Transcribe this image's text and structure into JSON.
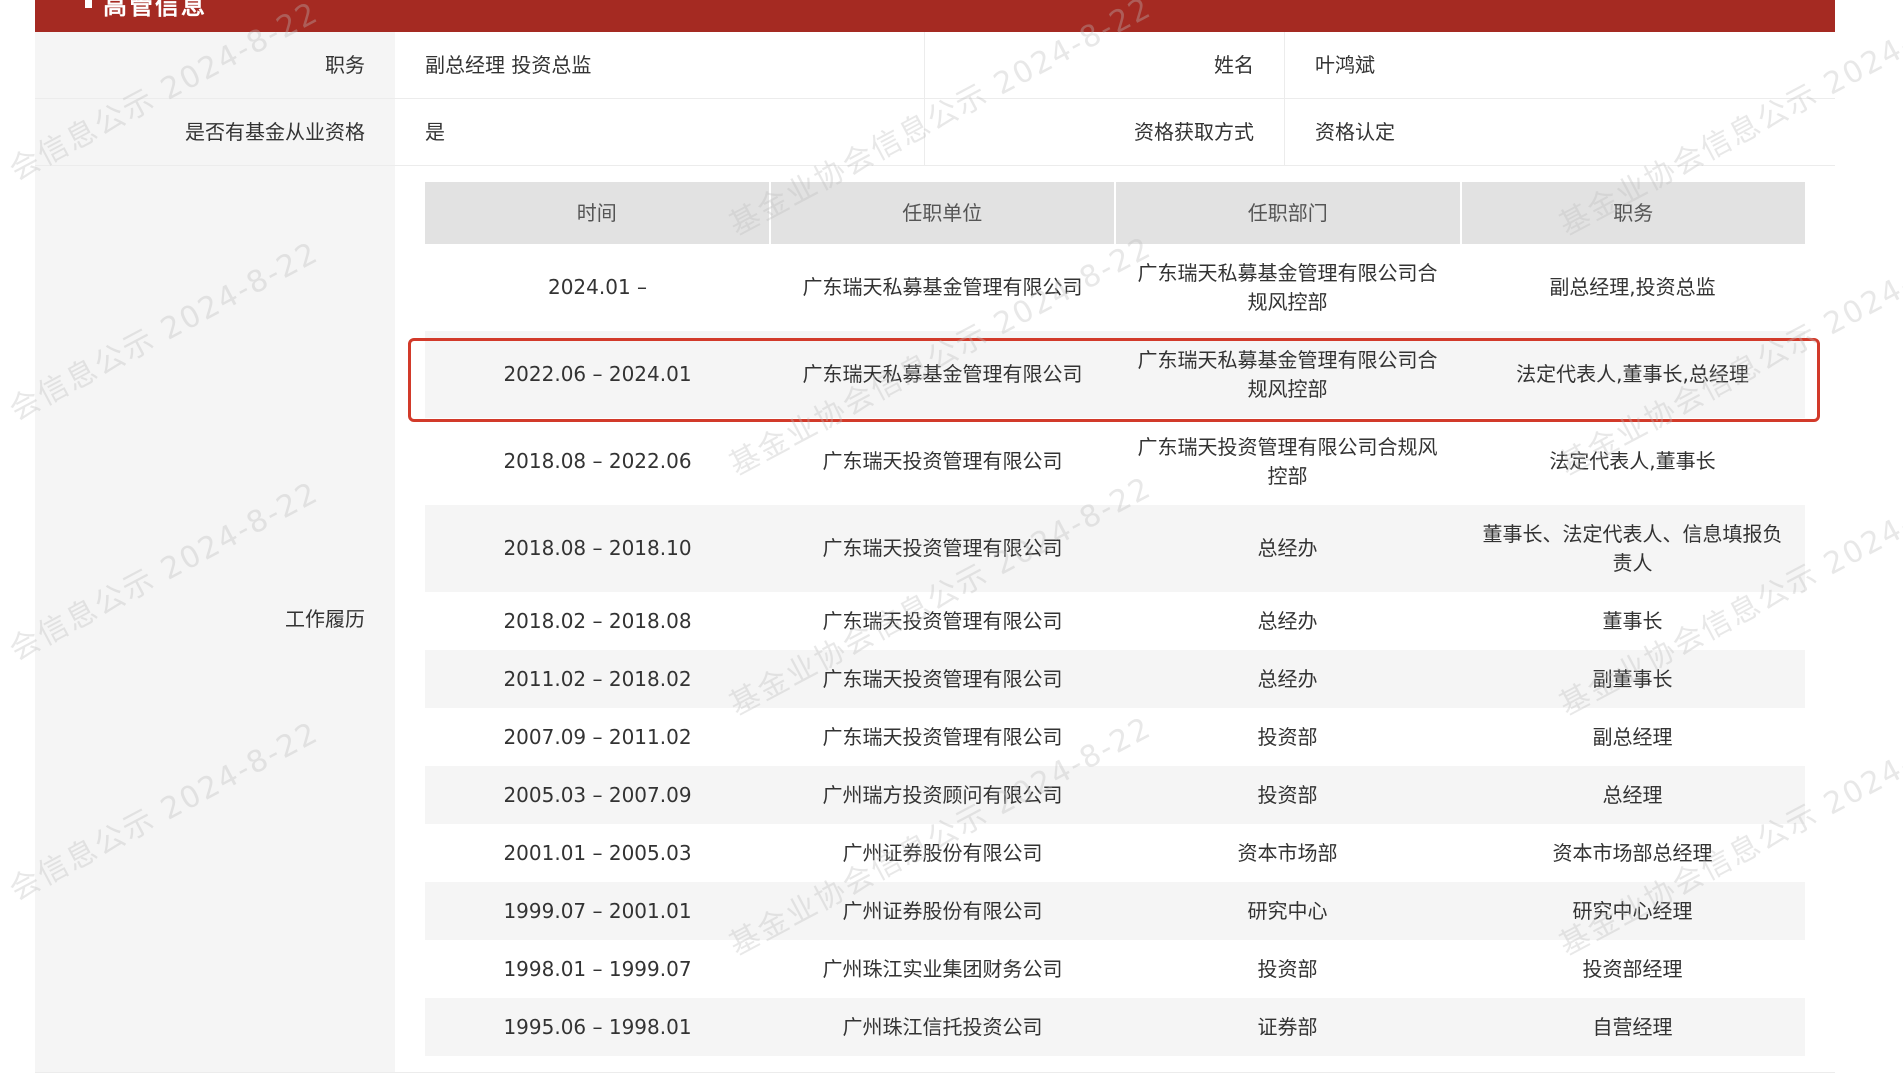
{
  "section": {
    "title": "高管信息"
  },
  "info": {
    "position_label": "职务",
    "position_value": "副总经理 投资总监",
    "name_label": "姓名",
    "name_value": "叶鸿斌",
    "qualification_label": "是否有基金从业资格",
    "qualification_value": "是",
    "method_label": "资格获取方式",
    "method_value": "资格认定"
  },
  "work_history": {
    "label": "工作履历",
    "headers": [
      "时间",
      "任职单位",
      "任职部门",
      "职务"
    ],
    "rows": [
      [
        "2024.01 –",
        "广东瑞天私募基金管理有限公司",
        "广东瑞天私募基金管理有限公司合规风控部",
        "副总经理,投资总监"
      ],
      [
        "2022.06 – 2024.01",
        "广东瑞天私募基金管理有限公司",
        "广东瑞天私募基金管理有限公司合规风控部",
        "法定代表人,董事长,总经理"
      ],
      [
        "2018.08 – 2022.06",
        "广东瑞天投资管理有限公司",
        "广东瑞天投资管理有限公司合规风控部",
        "法定代表人,董事长"
      ],
      [
        "2018.08 – 2018.10",
        "广东瑞天投资管理有限公司",
        "总经办",
        "董事长、法定代表人、信息填报负责人"
      ],
      [
        "2018.02 – 2018.08",
        "广东瑞天投资管理有限公司",
        "总经办",
        "董事长"
      ],
      [
        "2011.02 – 2018.02",
        "广东瑞天投资管理有限公司",
        "总经办",
        "副董事长"
      ],
      [
        "2007.09 – 2011.02",
        "广东瑞天投资管理有限公司",
        "投资部",
        "副总经理"
      ],
      [
        "2005.03 – 2007.09",
        "广州瑞方投资顾问有限公司",
        "投资部",
        "总经理"
      ],
      [
        "2001.01 – 2005.03",
        "广州证券股份有限公司",
        "资本市场部",
        "资本市场部总经理"
      ],
      [
        "1999.07 – 2001.01",
        "广州证券股份有限公司",
        "研究中心",
        "研究中心经理"
      ],
      [
        "1998.01 – 1999.07",
        "广州珠江实业集团财务公司",
        "投资部",
        "投资部经理"
      ],
      [
        "1995.06 – 1998.01",
        "广州珠江信托投资公司",
        "证券部",
        "自营经理"
      ]
    ]
  },
  "watermark": {
    "text_a": "会信息公示 2024-8-22",
    "text_b": "基金业协会信息公示 2024-8-22"
  },
  "colors": {
    "header_bar": "#a52a22",
    "highlight_border": "#d23a2a"
  }
}
